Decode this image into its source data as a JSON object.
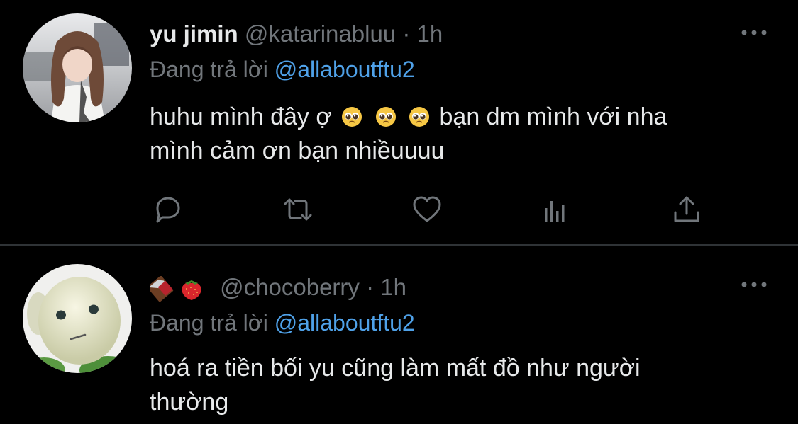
{
  "tweets": [
    {
      "display_name": "yu jimin",
      "handle": "@katarinabluu",
      "separator": "·",
      "time": "1h",
      "reply_prefix": "Đang trả lời",
      "reply_to": "@allaboutftu2",
      "body_part1": "huhu mình đây ợ",
      "body_part2": "bạn dm mình với nha",
      "body_line2": "mình cảm ơn bạn nhiềuuuu",
      "body_emojis": [
        "pleading-face",
        "pleading-face",
        "pleading-face"
      ],
      "actions": [
        "reply-icon",
        "retweet-icon",
        "like-icon",
        "analytics-icon",
        "share-icon"
      ]
    },
    {
      "display_name_emojis": [
        "chocolate-bar",
        "strawberry"
      ],
      "handle": "@chocoberry",
      "separator": "·",
      "time": "1h",
      "reply_prefix": "Đang trả lời",
      "reply_to": "@allaboutftu2",
      "body_line1": "hoá ra tiền bối yu cũng làm mất đồ như người",
      "body_line2": "thường"
    }
  ],
  "colors": {
    "background": "#000000",
    "text": "#e7e9ea",
    "secondary": "#71767b",
    "link": "#4fa1e8",
    "divider": "#2f3336"
  }
}
